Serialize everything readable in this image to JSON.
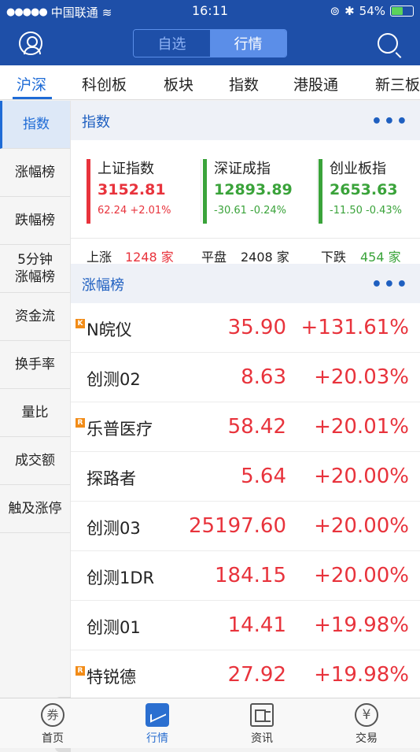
{
  "status": {
    "carrier": "中国联通",
    "time": "16:11",
    "battery": "54%"
  },
  "header": {
    "seg_watch": "自选",
    "seg_market": "行情"
  },
  "tabs": [
    "沪深",
    "科创板",
    "板块",
    "指数",
    "港股通",
    "新三板"
  ],
  "sidebar": [
    "指数",
    "涨幅榜",
    "跌幅榜",
    "5分钟",
    "涨幅榜",
    "资金流",
    "换手率",
    "量比",
    "成交额",
    "触及涨停"
  ],
  "index_section": {
    "title": "指数",
    "indices": [
      {
        "name": "上证指数",
        "value": "3152.81",
        "change": "62.24 +2.01%",
        "color": "#e8333c"
      },
      {
        "name": "深证成指",
        "value": "12893.89",
        "change": "-30.61 -0.24%",
        "color": "#3aa33a"
      },
      {
        "name": "创业板指",
        "value": "2653.63",
        "change": "-11.50 -0.43%",
        "color": "#3aa33a"
      }
    ],
    "breadth": {
      "up_label": "上涨",
      "up_count": "1248 家",
      "flat_label": "平盘",
      "flat_count": "2408 家",
      "down_label": "下跌",
      "down_count": "454 家"
    }
  },
  "gainers_section": {
    "title": "涨幅榜",
    "rows": [
      {
        "badge": "K",
        "name": "N皖仪",
        "price": "35.90",
        "pct": "+131.61%"
      },
      {
        "badge": "",
        "name": "创测02",
        "price": "8.63",
        "pct": "+20.03%"
      },
      {
        "badge": "R",
        "name": "乐普医疗",
        "price": "58.42",
        "pct": "+20.01%"
      },
      {
        "badge": "",
        "name": "探路者",
        "price": "5.64",
        "pct": "+20.00%"
      },
      {
        "badge": "",
        "name": "创测03",
        "price": "25197.60",
        "pct": "+20.00%"
      },
      {
        "badge": "",
        "name": "创测1DR",
        "price": "184.15",
        "pct": "+20.00%"
      },
      {
        "badge": "",
        "name": "创测01",
        "price": "14.41",
        "pct": "+19.98%"
      },
      {
        "badge": "R",
        "name": "特锐德",
        "price": "27.92",
        "pct": "+19.98%"
      }
    ]
  },
  "tabbar": [
    {
      "label": "首页",
      "icon": "coupon-icon",
      "glyph": "券"
    },
    {
      "label": "行情",
      "icon": "chart-icon",
      "glyph": ""
    },
    {
      "label": "资讯",
      "icon": "news-icon",
      "glyph": ""
    },
    {
      "label": "交易",
      "icon": "yuan-icon",
      "glyph": "¥"
    }
  ]
}
